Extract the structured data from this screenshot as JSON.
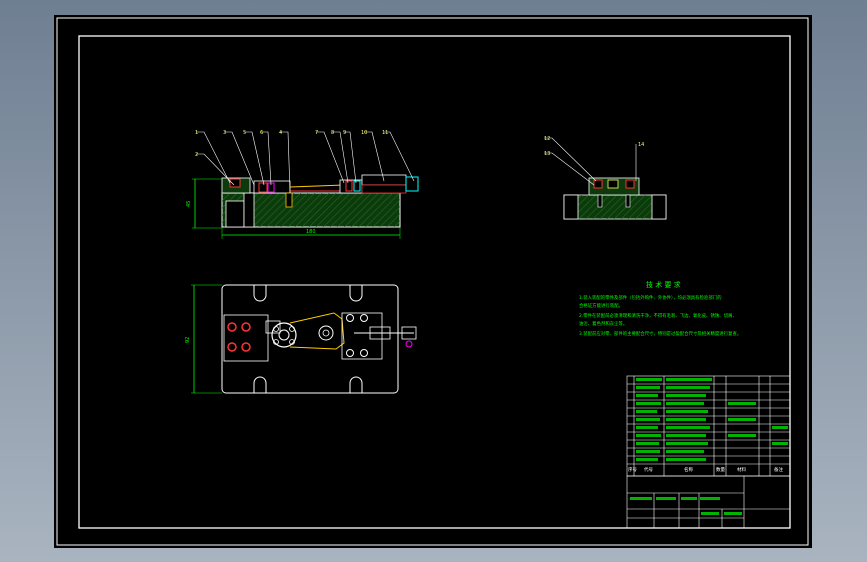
{
  "app": {
    "bg_color": "#000000",
    "frame_color": "#ffffff"
  },
  "balloons_front": [
    "1",
    "3",
    "5",
    "6",
    "4",
    "7",
    "8",
    "9",
    "10",
    "11",
    "2"
  ],
  "balloons_side": [
    "12",
    "13",
    "14"
  ],
  "dimensions": {
    "height": "45",
    "length": "180",
    "plan_height": "92"
  },
  "tech_title": "技 术 要 求",
  "tech_lines": [
    "1.装入装配的零件及部件（包括外购件、外协件），均必须具有检验部门的",
    "合格证方能进行装配。",
    "2.零件在装配前必须清理和清洗干净，不得有毛刺、飞边、氧化皮、锈蚀、切屑、",
    "油污、着色剂和灰尘等。",
    "3.装配前应对零、部件的主要配合尺寸，特别是过盈配合尺寸及相关精度进行复查。"
  ],
  "title_block": {
    "header_seq": "序号",
    "header_code": "代号",
    "header_name": "名称",
    "header_qty": "数量",
    "header_material": "材料",
    "header_remark": "备注"
  }
}
